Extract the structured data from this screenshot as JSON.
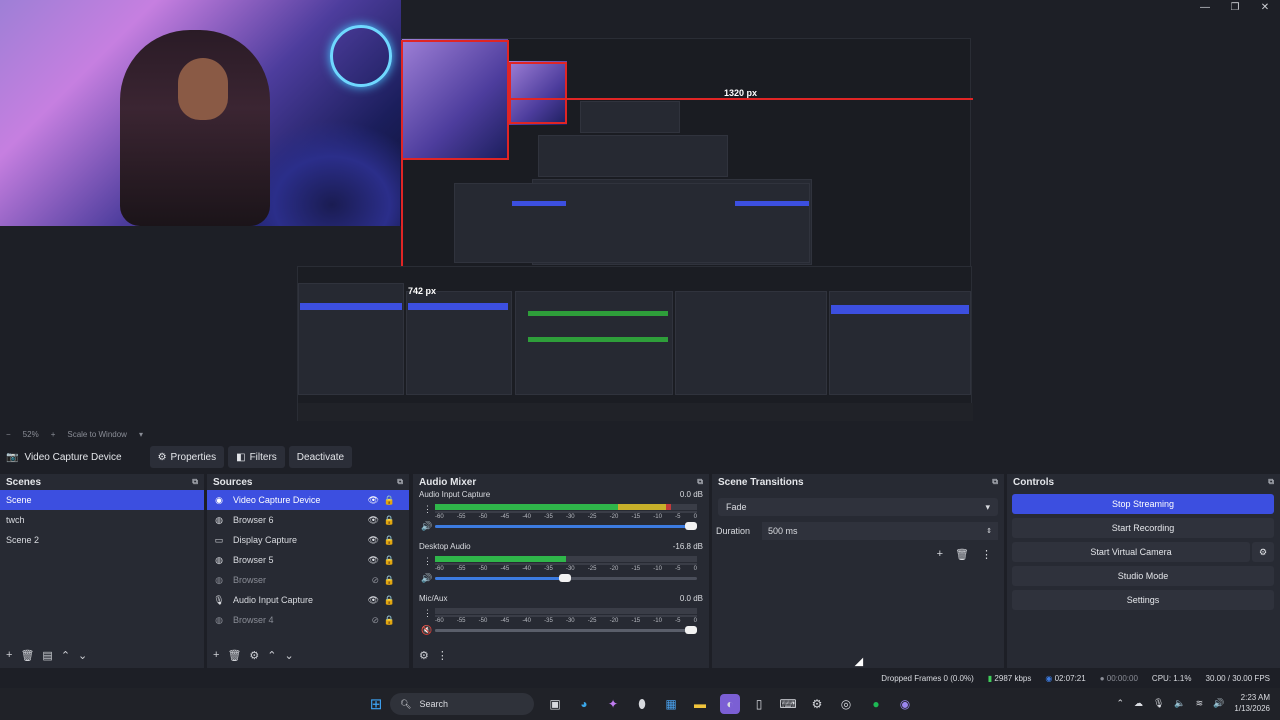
{
  "window": {
    "controls": [
      "—",
      "❐",
      "✕"
    ]
  },
  "preview": {
    "measure_width": "1320 px",
    "measure_height": "742 px"
  },
  "zoombar": {
    "zoom_label": "52%",
    "scale_mode": "Scale to Window"
  },
  "source_toolbar": {
    "selected_source": "Video Capture Device",
    "properties": "Properties",
    "filters": "Filters",
    "deactivate": "Deactivate"
  },
  "scenes": {
    "title": "Scenes",
    "items": [
      "Scene",
      "twch",
      "Scene 2"
    ],
    "selected_index": 0
  },
  "sources": {
    "title": "Sources",
    "items": [
      {
        "name": "Video Capture Device",
        "icon": "camera-icon",
        "visible": true,
        "selected": true
      },
      {
        "name": "Browser 6",
        "icon": "globe-icon",
        "visible": true,
        "selected": false
      },
      {
        "name": "Display Capture",
        "icon": "monitor-icon",
        "visible": true,
        "selected": false
      },
      {
        "name": "Browser 5",
        "icon": "globe-icon",
        "visible": true,
        "selected": false
      },
      {
        "name": "Browser",
        "icon": "globe-icon",
        "visible": false,
        "selected": false
      },
      {
        "name": "Audio Input Capture",
        "icon": "mic-icon",
        "visible": true,
        "selected": false
      },
      {
        "name": "Browser 4",
        "icon": "globe-icon",
        "visible": false,
        "selected": false
      }
    ]
  },
  "mixer": {
    "title": "Audio Mixer",
    "channels": [
      {
        "name": "Audio Input Capture",
        "db": "0.0 dB",
        "level": 0.9,
        "fader": 1.0,
        "muted": false
      },
      {
        "name": "Desktop Audio",
        "db": "-16.8 dB",
        "level": 0.5,
        "fader": 0.52,
        "muted": false
      },
      {
        "name": "Mic/Aux",
        "db": "0.0 dB",
        "level": 0.0,
        "fader": 1.0,
        "muted": true
      }
    ],
    "scale": [
      "-60",
      "-55",
      "-50",
      "-45",
      "-40",
      "-35",
      "-30",
      "-25",
      "-20",
      "-15",
      "-10",
      "-5",
      "0"
    ]
  },
  "transitions": {
    "title": "Scene Transitions",
    "selected": "Fade",
    "duration_label": "Duration",
    "duration_value": "500 ms"
  },
  "controls": {
    "title": "Controls",
    "stop_streaming": "Stop Streaming",
    "start_recording": "Start Recording",
    "start_virtual_camera": "Start Virtual Camera",
    "studio_mode": "Studio Mode",
    "settings": "Settings"
  },
  "status": {
    "dropped_frames": "Dropped Frames 0 (0.0%)",
    "bitrate": "2987 kbps",
    "stream_time": "02:07:21",
    "record_time": "00:00:00",
    "cpu": "CPU: 1.1%",
    "fps": "30.00 / 30.00 FPS"
  },
  "taskbar": {
    "search_placeholder": "Search",
    "time": "2:23 AM",
    "date": "1/13/2026"
  }
}
